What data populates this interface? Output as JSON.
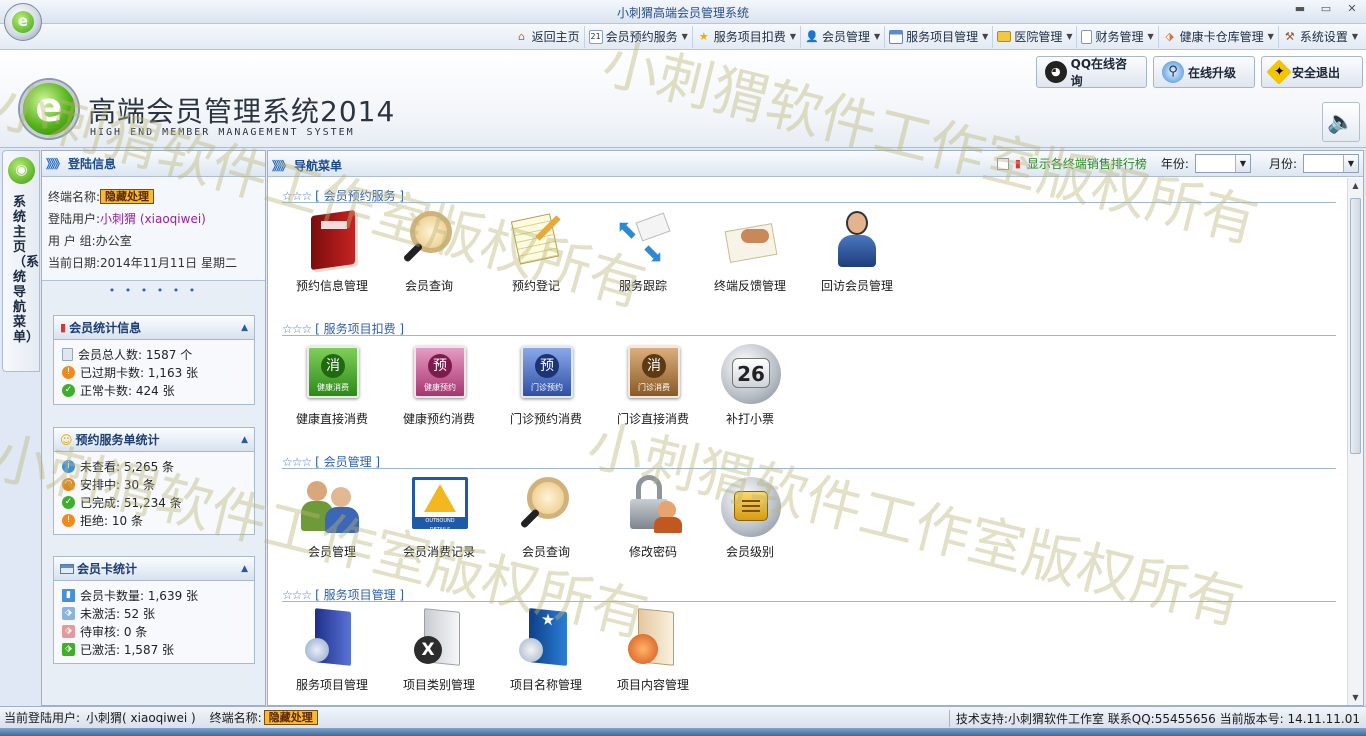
{
  "window": {
    "title": "小刺猬高端会员管理系统",
    "minimize": "▬",
    "maximize": "▭",
    "close": "✕"
  },
  "menu": [
    {
      "label": "返回主页",
      "icon": "home-icon",
      "dropdown": false
    },
    {
      "label": "会员预约服务",
      "icon": "calendar-icon",
      "dropdown": true
    },
    {
      "label": "服务项目扣费",
      "icon": "star-icon",
      "dropdown": true
    },
    {
      "label": "会员管理",
      "icon": "user-icon",
      "dropdown": true
    },
    {
      "label": "服务项目管理",
      "icon": "window-icon",
      "dropdown": true
    },
    {
      "label": "医院管理",
      "icon": "folder-icon",
      "dropdown": true
    },
    {
      "label": "财务管理",
      "icon": "document-icon",
      "dropdown": true
    },
    {
      "label": "健康卡仓库管理",
      "icon": "tag-icon",
      "dropdown": true
    },
    {
      "label": "系统设置",
      "icon": "tools-icon",
      "dropdown": true
    }
  ],
  "header": {
    "logo_title": "高端会员管理系统2014",
    "logo_subtitle": "HIGH END MEMBER MANAGEMENT SYSTEM",
    "buttons": {
      "qq": "QQ在线咨询",
      "upgrade": "在线升级",
      "logout": "安全退出"
    }
  },
  "vtab": {
    "label": "系统主页（系统导航菜单）"
  },
  "login": {
    "panel_title": "登陆信息",
    "terminal_label": "终端名称:",
    "terminal_value": "隐藏处理",
    "user_label": "登陆用户:",
    "user_value": "小刺猬 (xiaoqiwei)",
    "group_label": "用 户 组:",
    "group_value": "办公室",
    "date_label": "当前日期:",
    "date_value": "2014年11月11日 星期二",
    "dots": "• • • • • •"
  },
  "stats": {
    "member": {
      "title": "会员统计信息",
      "rows": [
        {
          "text": "会员总人数: 1587 个",
          "color": "#b9c6d8"
        },
        {
          "text": "已过期卡数: 1,163 张",
          "color": "#f08a1c"
        },
        {
          "text": "正常卡数: 424 张",
          "color": "#3fae2a"
        }
      ]
    },
    "booking": {
      "title": "预约服务单统计",
      "rows": [
        {
          "text": "未查看: 5,265 条",
          "color": "#3b8fdc"
        },
        {
          "text": "安排中: 30 条",
          "color": "#e2861d"
        },
        {
          "text": "已完成: 51,234 条",
          "color": "#3fae2a"
        },
        {
          "text": "拒绝: 10 条",
          "color": "#f08a1c"
        }
      ]
    },
    "card": {
      "title": "会员卡统计",
      "rows": [
        {
          "text": "会员卡数量: 1,639 张",
          "color": "#4a90d8"
        },
        {
          "text": "未激活: 52 张",
          "color": "#8ab4de"
        },
        {
          "text": "待审核: 0 条",
          "color": "#e39a9a"
        },
        {
          "text": "已激活: 1,587 张",
          "color": "#3fae2a"
        }
      ]
    }
  },
  "main": {
    "title": "导航菜单",
    "rank_label": "显示各终端销售排行榜",
    "year_label": "年份:",
    "month_label": "月份:",
    "year_value": "",
    "month_value": "",
    "stars": "☆☆☆",
    "sections": [
      {
        "title": "[ 会员预约服务 ]",
        "items": [
          "预约信息管理",
          "会员查询",
          "预约登记",
          "服务跟踪",
          "终端反馈管理",
          "回访会员管理"
        ]
      },
      {
        "title": "[ 服务项目扣费 ]",
        "items": [
          "健康直接消费",
          "健康预约消费",
          "门诊预约消费",
          "门诊直接消费",
          "补打小票"
        ]
      },
      {
        "title": "[ 会员管理 ]",
        "items": [
          "会员管理",
          "会员消费记录",
          "会员查询",
          "修改密码",
          "会员级别"
        ]
      },
      {
        "title": "[ 服务项目管理 ]",
        "items": [
          "服务项目管理",
          "项目类别管理",
          "项目名称管理",
          "项目内容管理"
        ]
      }
    ],
    "card_icons": {
      "health_label": "健康消费",
      "health_book_label": "健康预约",
      "clinic_book_label": "门诊预约",
      "clinic_label": "门诊消费",
      "char_consume": "消",
      "char_book": "预",
      "ticket_number": "26",
      "outbound_label": "OUTBOUND DETAILS"
    }
  },
  "watermark": "小刺猬软件工作室版权所有",
  "statusbar": {
    "user_label": "当前登陆用户:",
    "user_value": "小刺猬( xiaoqiwei )",
    "terminal_label": "终端名称:",
    "terminal_value": "隐藏处理",
    "right_text": "技术支持:小刺猬软件工作室 联系QQ:55455656 当前版本号: 14.11.11.01"
  }
}
